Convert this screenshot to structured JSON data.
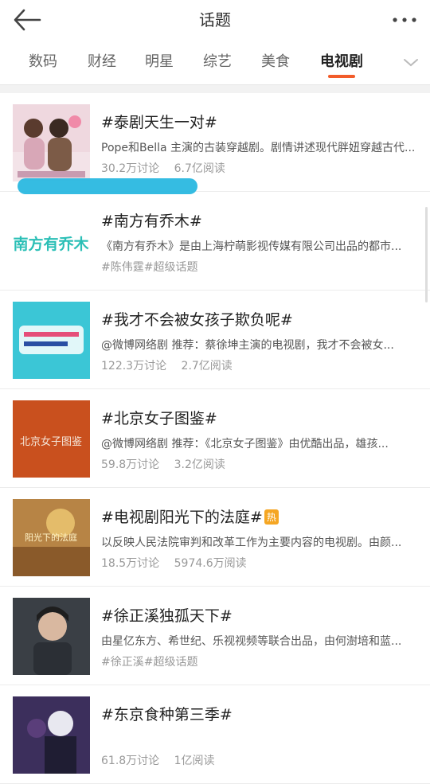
{
  "header": {
    "title": "话题"
  },
  "tabs": [
    {
      "label": "数码",
      "active": false
    },
    {
      "label": "财经",
      "active": false
    },
    {
      "label": "明星",
      "active": false
    },
    {
      "label": "综艺",
      "active": false
    },
    {
      "label": "美食",
      "active": false
    },
    {
      "label": "电视剧",
      "active": true
    }
  ],
  "accent_color": "#f25c2a",
  "items": [
    {
      "title": "#泰剧天生一对#",
      "desc": "Pope和Bella 主演的古装穿越剧。剧情讲述现代胖妞穿越古代...",
      "discuss": "30.2万讨论",
      "reads": "6.7亿阅读",
      "hot": ""
    },
    {
      "title": "#南方有乔木#",
      "desc": "《南方有乔木》是由上海柠萌影视传媒有限公司出品的都市...",
      "discuss": "#陈伟霆#超级话题",
      "reads": "",
      "hot": "",
      "thumb_text": "南方有乔木"
    },
    {
      "title": "#我才不会被女孩子欺负呢#",
      "desc": "@微博网络剧 推荐：蔡徐坤主演的电视剧，我才不会被女...",
      "discuss": "122.3万讨论",
      "reads": "2.7亿阅读",
      "hot": ""
    },
    {
      "title": "#北京女子图鉴#",
      "desc": "@微博网络剧 推荐：《北京女子图鉴》由优酷出品，雄孩...",
      "discuss": "59.8万讨论",
      "reads": "3.2亿阅读",
      "hot": "",
      "thumb_text": "北京女子图鉴"
    },
    {
      "title": "#电视剧阳光下的法庭#",
      "desc": "以反映人民法院审判和改革工作为主要内容的电视剧。由颜...",
      "discuss": "18.5万讨论",
      "reads": "5974.6万阅读",
      "hot": "热",
      "thumb_text": "阳光下的法庭"
    },
    {
      "title": "#徐正溪独孤天下#",
      "desc": "由星亿东方、希世纪、乐视视频等联合出品，由何澍培和蓝...",
      "discuss": "#徐正溪#超级话题",
      "reads": "",
      "hot": ""
    },
    {
      "title": "#东京食种第三季#",
      "desc": "",
      "discuss": "61.8万讨论",
      "reads": "1亿阅读",
      "hot": ""
    }
  ]
}
